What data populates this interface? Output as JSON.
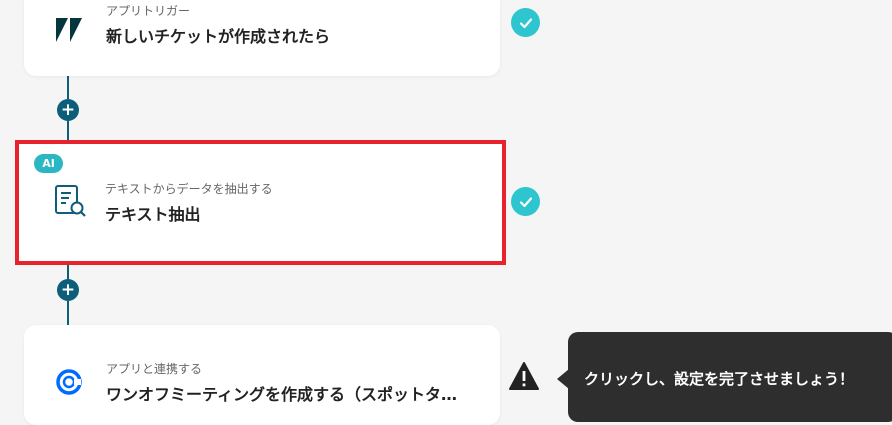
{
  "steps": [
    {
      "subtitle": "アプリトリガー",
      "title": "新しいチケットが作成されたら",
      "icon": "zendesk-logo-icon"
    },
    {
      "badge": "AI",
      "subtitle": "テキストからデータを抽出する",
      "title": "テキスト抽出",
      "icon": "document-search-icon"
    },
    {
      "subtitle": "アプリと連携する",
      "title": "ワンオフミーティングを作成する（スポットタ…",
      "icon": "calendly-logo-icon"
    }
  ],
  "tooltip": {
    "text": "クリックし、設定を完了させましょう！"
  },
  "colors": {
    "accent": "#0d5e79",
    "check": "#2dc5cf",
    "highlight": "#e8232e",
    "ai_badge": "#2bb6c4"
  }
}
